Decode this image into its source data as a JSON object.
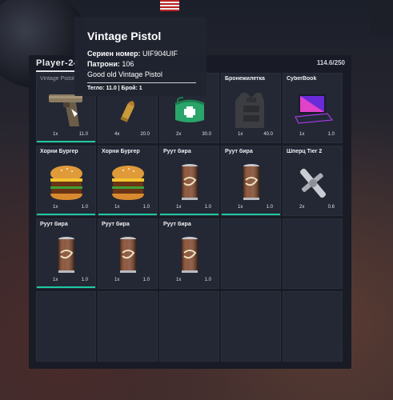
{
  "header": {
    "player_name": "Player-24",
    "weight": "114.6/250"
  },
  "colors": {
    "accent": "#1ec9a2",
    "panel": "#181b25",
    "slot": "#232834"
  },
  "slots": [
    {
      "label": "Vintage Pistol",
      "count": "1x",
      "weight": "11.0",
      "icon": "pistol-icon",
      "bar": true,
      "dim": true
    },
    {
      "label": "",
      "count": "4x",
      "weight": "20.0",
      "icon": "ammo-icon",
      "bar": false
    },
    {
      "label": "",
      "count": "2x",
      "weight": "30.0",
      "icon": "firstaid-icon",
      "bar": false
    },
    {
      "label": "Бронежилетка",
      "count": "1x",
      "weight": "40.0",
      "icon": "armor-icon",
      "bar": false
    },
    {
      "label": "CyberBook",
      "count": "1x",
      "weight": "1.0",
      "icon": "laptop-icon",
      "bar": false
    },
    {
      "label": "Хорни Бургер",
      "count": "1x",
      "weight": "1.0",
      "icon": "burger-icon",
      "bar": true
    },
    {
      "label": "Хорни Бургер",
      "count": "1x",
      "weight": "1.0",
      "icon": "burger-icon",
      "bar": true
    },
    {
      "label": "Руут бира",
      "count": "1x",
      "weight": "1.0",
      "icon": "can-icon",
      "bar": true
    },
    {
      "label": "Руут бира",
      "count": "1x",
      "weight": "1.0",
      "icon": "can-icon",
      "bar": true
    },
    {
      "label": "Шперц Tier 2",
      "count": "2x",
      "weight": "0.6",
      "icon": "lockpick-icon",
      "bar": false
    },
    {
      "label": "Руут бира",
      "count": "1x",
      "weight": "1.0",
      "icon": "can-icon",
      "bar": true
    },
    {
      "label": "Руут бира",
      "count": "1x",
      "weight": "1.0",
      "icon": "can-icon",
      "bar": false
    },
    {
      "label": "Руут бира",
      "count": "1x",
      "weight": "1.0",
      "icon": "can-icon",
      "bar": false
    }
  ],
  "tooltip": {
    "title": "Vintage Pistol",
    "serial_label": "Сериен номер:",
    "serial_value": "UIF904UIF",
    "ammo_label": "Патрони:",
    "ammo_value": "106",
    "description": "Good old Vintage Pistol",
    "footer": "Тегло: 11.0 | Брой: 1"
  }
}
